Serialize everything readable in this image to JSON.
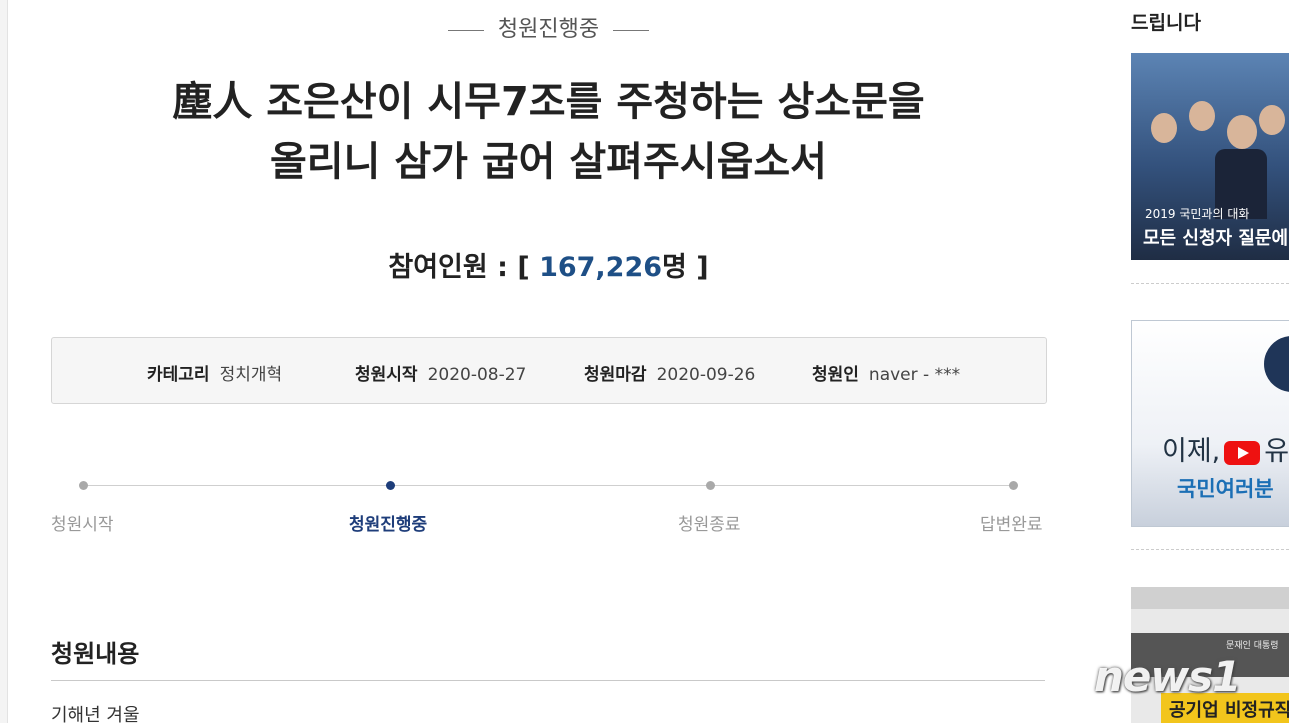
{
  "petition": {
    "status": "청원진행중",
    "title_line1": "塵人 조은산이 시무7조를 주청하는 상소문을",
    "title_line2": "올리니 삼가 굽어 살펴주시옵소서",
    "count_label": "참여인원 : [",
    "count_value": "167,226",
    "count_unit": "명 ]",
    "info": {
      "category_label": "카테고리",
      "category_value": "정치개혁",
      "start_label": "청원시작",
      "start_value": "2020-08-27",
      "end_label": "청원마감",
      "end_value": "2020-09-26",
      "author_label": "청원인",
      "author_value": "naver - ***"
    },
    "steps": [
      "청원시작",
      "청원진행중",
      "청원종료",
      "답변완료"
    ],
    "active_step": 1,
    "content_title": "청원내용",
    "content_first_line": "기해년 겨울"
  },
  "sidebar": {
    "top_text": "드립니다",
    "banner1_caption_small": "2019 국민과의 대화",
    "banner1_caption_large": "모든 신청자 질문에",
    "banner2_text1": "이제,",
    "banner2_text1b": "유",
    "banner2_text2": "국민여러분",
    "banner3_header": "문재인 대통령",
    "banner3_text": "공기업 비정규직"
  },
  "watermark": "news1",
  "colors": {
    "accent": "#1e4f86",
    "active_step": "#1e3d7a"
  }
}
